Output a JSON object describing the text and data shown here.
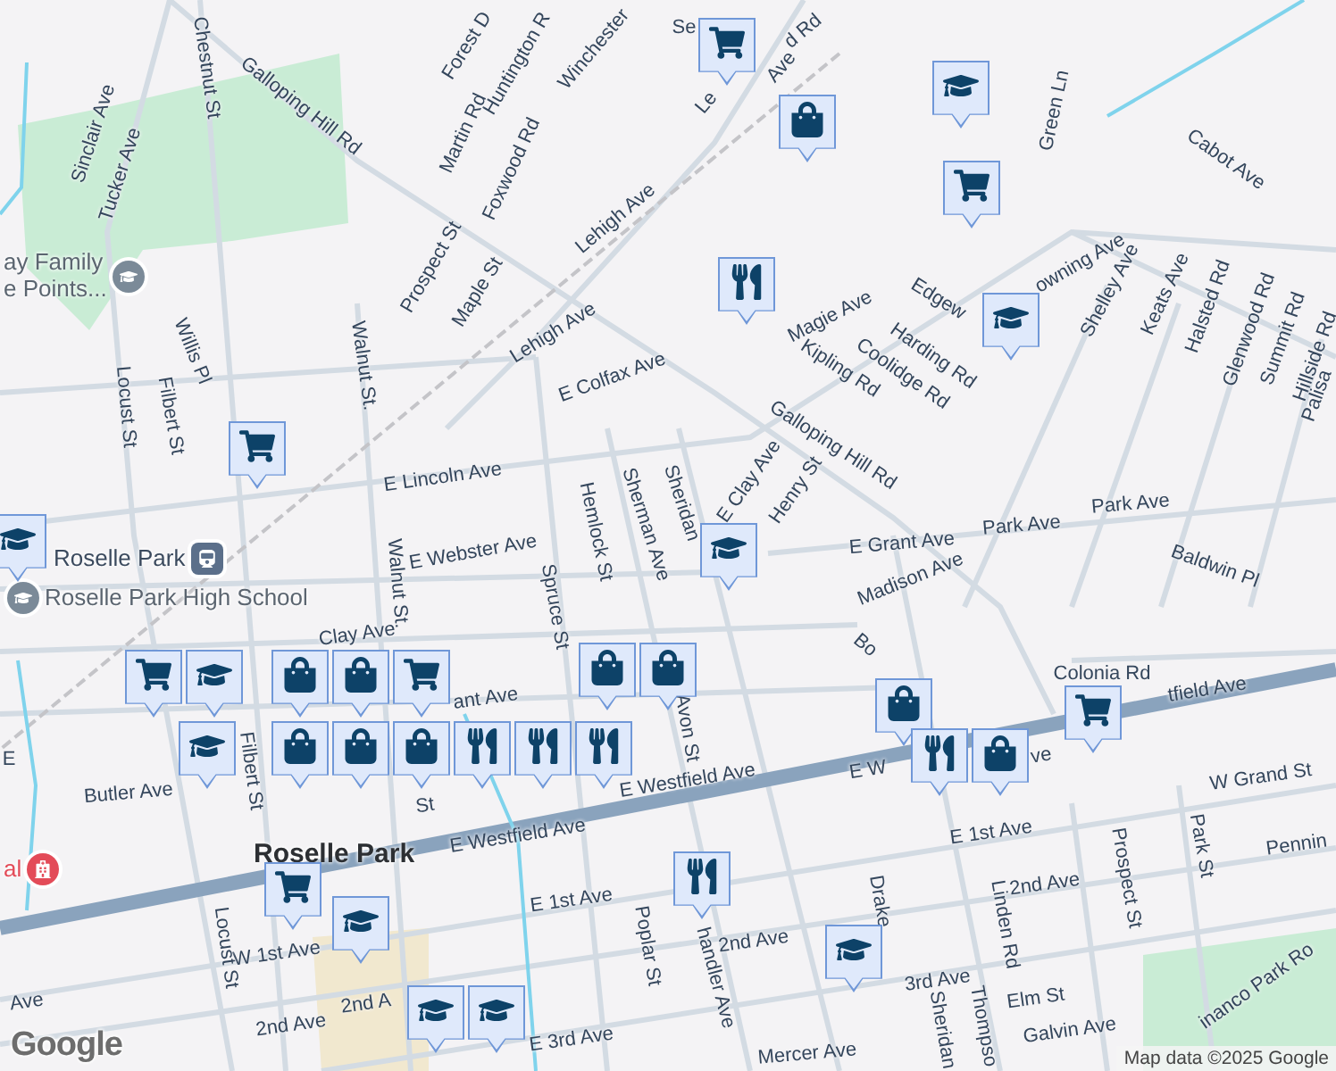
{
  "map": {
    "street_labels": [
      {
        "text": "Chestnut St"
      },
      {
        "text": "Galloping Hill Rd"
      },
      {
        "text": "Sinclair Ave"
      },
      {
        "text": "Tucker Ave"
      },
      {
        "text": "Forest D"
      },
      {
        "text": "Huntington R"
      },
      {
        "text": "Winchester"
      },
      {
        "text": "Se"
      },
      {
        "text": "d Rd"
      },
      {
        "text": "Le"
      },
      {
        "text": "Ave"
      },
      {
        "text": "Martin Rd"
      },
      {
        "text": "Foxwood Rd"
      },
      {
        "text": "Lehigh Ave"
      },
      {
        "text": "Prospect St"
      },
      {
        "text": "Maple St"
      },
      {
        "text": "Lehigh Ave"
      },
      {
        "text": "E Colfax Ave"
      },
      {
        "text": "Magie Ave"
      },
      {
        "text": "Kipling Rd"
      },
      {
        "text": "Coolidge Rd"
      },
      {
        "text": "Galloping Hill Rd"
      },
      {
        "text": "Harding Rd"
      },
      {
        "text": "Edgew"
      },
      {
        "text": "owning Ave"
      },
      {
        "text": "Green Ln"
      },
      {
        "text": "Cabot Ave"
      },
      {
        "text": "Shelley Ave"
      },
      {
        "text": "Keats Ave"
      },
      {
        "text": "Halsted Rd"
      },
      {
        "text": "Glenwood Rd"
      },
      {
        "text": "Summit Rd"
      },
      {
        "text": "Hillside Rd"
      },
      {
        "text": "Palisa"
      },
      {
        "text": "Willis Pl"
      },
      {
        "text": "Filbert St"
      },
      {
        "text": "Locust St"
      },
      {
        "text": "Walnut St."
      },
      {
        "text": "E Lincoln Ave"
      },
      {
        "text": "Hemlock St"
      },
      {
        "text": "Sherman Ave"
      },
      {
        "text": "Sheridan"
      },
      {
        "text": "E Clay Ave"
      },
      {
        "text": "Henry St"
      },
      {
        "text": "Park Ave"
      },
      {
        "text": "Park Ave"
      },
      {
        "text": "E Grant Ave"
      },
      {
        "text": "Madison Ave"
      },
      {
        "text": "Baldwin Pl"
      },
      {
        "text": "E Webster Ave"
      },
      {
        "text": "Spruce St"
      },
      {
        "text": "Walnut St."
      },
      {
        "text": "Clay Ave"
      },
      {
        "text": "Butler Ave"
      },
      {
        "text": "Filbert St"
      },
      {
        "text": "ant Ave"
      },
      {
        "text": "St"
      },
      {
        "text": "E"
      },
      {
        "text": "Avon St"
      },
      {
        "text": "E Westfield Ave"
      },
      {
        "text": "E Westfield Ave"
      },
      {
        "text": "E W"
      },
      {
        "text": "tfield Ave"
      },
      {
        "text": "ve"
      },
      {
        "text": "Bo"
      },
      {
        "text": "Colonia Rd"
      },
      {
        "text": "W Grand St"
      },
      {
        "text": "E 1st Ave"
      },
      {
        "text": "Pennin"
      },
      {
        "text": "Prospect St"
      },
      {
        "text": "Park St"
      },
      {
        "text": "2nd Ave"
      },
      {
        "text": "Linden Rd"
      },
      {
        "text": "Drake"
      },
      {
        "text": "Sheridan"
      },
      {
        "text": "Thompso"
      },
      {
        "text": "3rd Ave"
      },
      {
        "text": "Elm St"
      },
      {
        "text": "Galvin Ave"
      },
      {
        "text": "inanco Park Ro"
      },
      {
        "text": "Mercer Ave"
      },
      {
        "text": "E 3rd Ave"
      },
      {
        "text": "2nd Ave"
      },
      {
        "text": "handler Ave"
      },
      {
        "text": "Poplar St"
      },
      {
        "text": "E 1st Ave"
      },
      {
        "text": "W 1st Ave"
      },
      {
        "text": "Ave"
      },
      {
        "text": "2nd Ave"
      },
      {
        "text": "2nd A"
      },
      {
        "text": "Locust St"
      }
    ],
    "places": [
      {
        "kind": "school",
        "lines": [
          "ay Family",
          "e Points..."
        ]
      },
      {
        "kind": "station",
        "lines": [
          "Roselle Park"
        ]
      },
      {
        "kind": "school",
        "lines": [
          "Roselle Park High School"
        ]
      },
      {
        "kind": "hospital",
        "lines": [
          "al"
        ]
      },
      {
        "kind": "town",
        "lines": [
          "Roselle Park"
        ]
      }
    ],
    "markers": [
      {
        "kind": "grocery"
      },
      {
        "kind": "shopping"
      },
      {
        "kind": "school"
      },
      {
        "kind": "grocery"
      },
      {
        "kind": "restaurant"
      },
      {
        "kind": "school"
      },
      {
        "kind": "grocery"
      },
      {
        "kind": "school"
      },
      {
        "kind": "school"
      },
      {
        "kind": "school"
      },
      {
        "kind": "school"
      },
      {
        "kind": "grocery"
      },
      {
        "kind": "shopping"
      },
      {
        "kind": "shopping"
      },
      {
        "kind": "grocery"
      },
      {
        "kind": "shopping"
      },
      {
        "kind": "shopping"
      },
      {
        "kind": "shopping"
      },
      {
        "kind": "restaurant"
      },
      {
        "kind": "shopping"
      },
      {
        "kind": "shopping"
      },
      {
        "kind": "restaurant"
      },
      {
        "kind": "restaurant"
      },
      {
        "kind": "shopping"
      },
      {
        "kind": "restaurant"
      },
      {
        "kind": "shopping"
      },
      {
        "kind": "grocery"
      },
      {
        "kind": "restaurant"
      },
      {
        "kind": "grocery"
      },
      {
        "kind": "school"
      },
      {
        "kind": "school"
      },
      {
        "kind": "school"
      },
      {
        "kind": "school"
      }
    ]
  },
  "logo": "Google",
  "attribution": "Map data ©2025 Google"
}
